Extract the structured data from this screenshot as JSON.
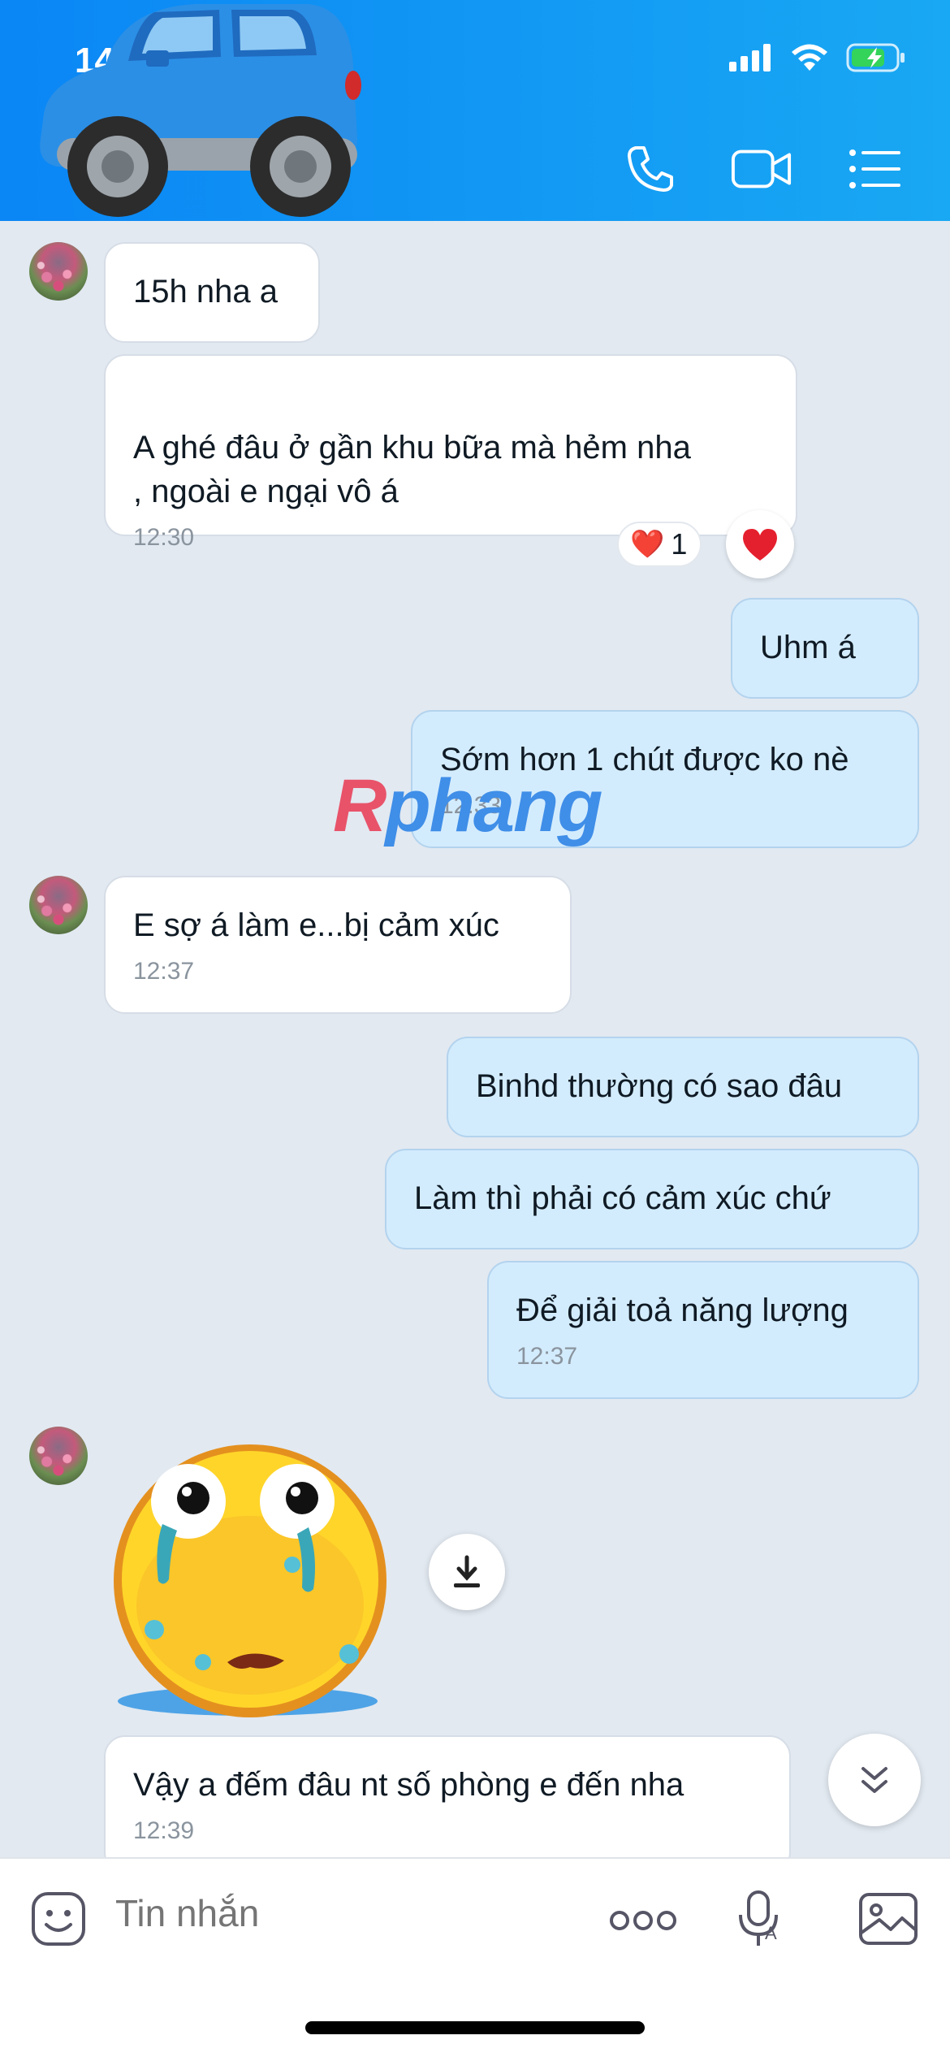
{
  "status_bar": {
    "time": "14"
  },
  "header": {
    "call_icon": "phone-icon",
    "video_icon": "video-camera-icon",
    "menu_icon": "list-menu-icon"
  },
  "messages": [
    {
      "side": "in",
      "text": "15h nha a"
    },
    {
      "side": "in",
      "text": "A ghé đâu ở gần khu bữa mà hẻm nha\n, ngoài e ngại vô á",
      "time": "12:30",
      "reaction": "❤️",
      "reaction_count": "1"
    },
    {
      "side": "out",
      "text": "Uhm á"
    },
    {
      "side": "out",
      "text": "Sớm hơn 1 chút được ko nè",
      "time": "12:33"
    },
    {
      "side": "in",
      "text": "E sợ á làm e...bị cảm xúc",
      "time": "12:37"
    },
    {
      "side": "out",
      "text": "Binhd thường có sao đâu"
    },
    {
      "side": "out",
      "text": "Làm thì phải có cảm xúc chứ"
    },
    {
      "side": "out",
      "text": "Để giải toả năng lượng",
      "time": "12:37"
    },
    {
      "side": "in",
      "sticker": "crying-face-sticker"
    },
    {
      "side": "in",
      "text": "Vậy a đếm đâu nt số phòng e đến nha",
      "time": "12:39"
    }
  ],
  "watermark": {
    "prefix": "R",
    "rest": "phang"
  },
  "input": {
    "placeholder": "Tin nhắn"
  },
  "colors": {
    "header": "#0a86f5",
    "outgoing_bubble": "#d3ecfd",
    "incoming_bubble": "#ffffff",
    "background": "#e2e9f1"
  }
}
